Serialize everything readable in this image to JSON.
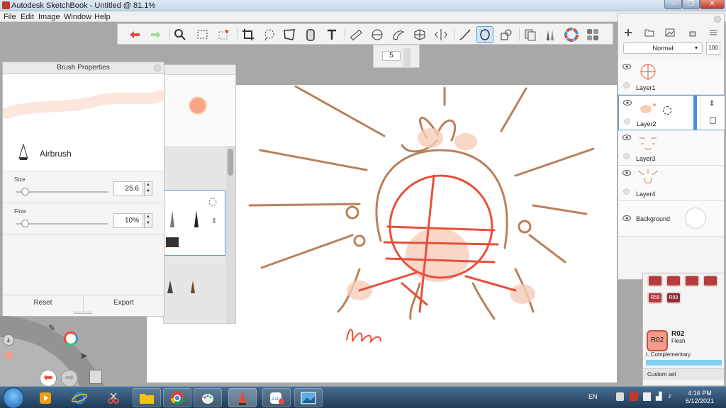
{
  "window": {
    "title": "Autodesk SketchBook - Untitled @ 81.1%",
    "controls": {
      "minimize": "–",
      "maximize": "❐",
      "close": "✕"
    }
  },
  "menu": [
    "File",
    "Edit",
    "Image",
    "Window",
    "Help"
  ],
  "toolbar": {
    "tools": [
      "undo-icon",
      "redo-icon",
      "zoom-icon",
      "select-icon",
      "transform-select-icon",
      "crop-icon",
      "lasso-icon",
      "distort-icon",
      "fill-icon",
      "text-icon",
      "ruler-icon",
      "ellipse-guide-icon",
      "french-curve-icon",
      "perspective-icon",
      "symmetry-icon",
      "stroke-icon",
      "ellipse-icon",
      "shape-icon",
      "copy-paste-icon",
      "brushes-icon",
      "color-wheel-icon",
      "copic-library-icon"
    ],
    "active_tool": "ellipse-icon",
    "stroke_width_value": "5"
  },
  "brush_properties": {
    "title": "Brush Properties",
    "brush_name": "Airbrush",
    "size": {
      "label": "Size",
      "value": "25.6",
      "fraction": 0.1
    },
    "flow": {
      "label": "Flow",
      "value": "10%",
      "fraction": 0.1
    },
    "reset_label": "Reset",
    "export_label": "Export"
  },
  "layers": {
    "blend_mode": "Normal",
    "opacity": "100",
    "items": [
      {
        "name": "Layer1",
        "selected": false
      },
      {
        "name": "Layer2",
        "selected": true
      },
      {
        "name": "Layer3",
        "selected": false
      },
      {
        "name": "Layer4",
        "selected": false
      }
    ],
    "background_label": "Background"
  },
  "copic": {
    "swatches": [
      "",
      "",
      "",
      "",
      "R59",
      "R89"
    ],
    "current_code": "R02",
    "current_name": "Flesh",
    "complementary_label": "t. Complementary",
    "custom_set_label": "Custom set"
  },
  "taskbar": {
    "language": "EN",
    "time": "4:16 PM",
    "date": "6/12/2021"
  },
  "colors": {
    "accent": "#5b9bd5",
    "sketch": "#b9805a",
    "red_lines": "#e8503a",
    "copic_current": "#f29c8a"
  }
}
